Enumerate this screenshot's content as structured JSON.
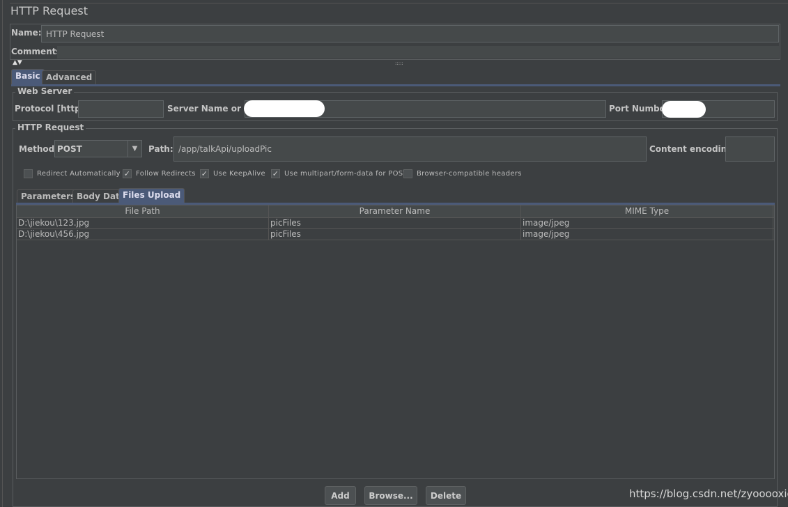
{
  "title": "HTTP Request",
  "name_label": "Name:",
  "name_value": "HTTP Request",
  "comments_label": "Comments:",
  "tabs": [
    "Basic",
    "Advanced"
  ],
  "web_server": {
    "title": "Web Server",
    "protocol_label": "Protocol [http]:",
    "server_label": "Server Name or IP:",
    "port_label": "Port Number:"
  },
  "http_request": {
    "title": "HTTP Request",
    "method_label": "Method:",
    "method_value": "POST",
    "path_label": "Path:",
    "path_value": "/app/talkApi/uploadPic",
    "encoding_label": "Content encoding:"
  },
  "checkboxes": [
    {
      "label": "Redirect Automatically",
      "checked": false
    },
    {
      "label": "Follow Redirects",
      "checked": true
    },
    {
      "label": "Use KeepAlive",
      "checked": true
    },
    {
      "label": "Use multipart/form-data for POST",
      "checked": true
    },
    {
      "label": "Browser-compatible headers",
      "checked": false
    }
  ],
  "sub_tabs": [
    "Parameters",
    "Body Data",
    "Files Upload"
  ],
  "table": {
    "headers": [
      "File Path",
      "Parameter Name",
      "MIME Type"
    ],
    "rows": [
      [
        "D:\\jiekou\\123.jpg",
        "picFiles",
        "image/jpeg"
      ],
      [
        "D:\\jiekou\\456.jpg",
        "picFiles",
        "image/jpeg"
      ]
    ]
  },
  "buttons": {
    "add": "Add",
    "browse": "Browse...",
    "delete": "Delete"
  },
  "watermark": "https://blog.csdn.net/zyooooxie"
}
